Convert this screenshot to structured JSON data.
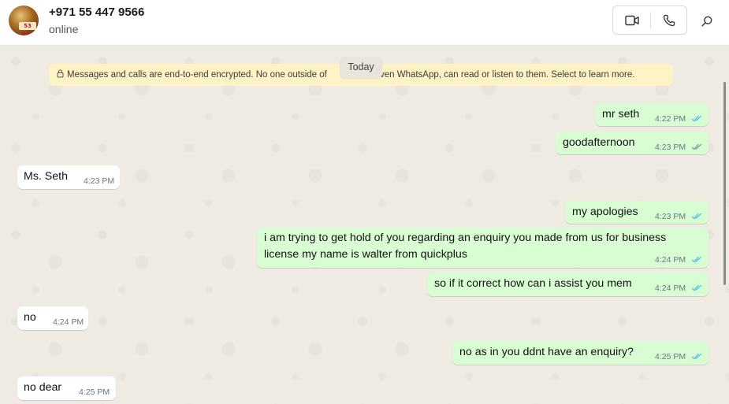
{
  "header": {
    "contact_name": "+971 55 447 9566",
    "status": "online",
    "avatar_badge": "53 UAE",
    "icons": [
      "video-call-icon",
      "voice-call-icon",
      "search-icon"
    ]
  },
  "chat": {
    "day_label": "Today",
    "encryption_notice": "Messages and calls are end-to-end encrypted. No one outside of             not even WhatsApp, can read or listen to them. Select to learn more.",
    "messages": [
      {
        "direction": "out",
        "text": "mr seth",
        "time": "4:22 PM",
        "read": true
      },
      {
        "direction": "out",
        "text": "goodafternoon",
        "time": "4:23 PM",
        "read": false
      },
      {
        "direction": "in",
        "text": "Ms. Seth",
        "time": "4:23 PM"
      },
      {
        "direction": "out",
        "text": "my apologies",
        "time": "4:23 PM",
        "read": true
      },
      {
        "direction": "out",
        "text": "i am trying to get hold of you regarding an enquiry you made from us for business license my name is walter from quickplus",
        "time": "4:24 PM",
        "read": true
      },
      {
        "direction": "out",
        "text": "so if it correct how can i assist you mem",
        "time": "4:24 PM",
        "read": true
      },
      {
        "direction": "in",
        "text": "no",
        "time": "4:24 PM"
      },
      {
        "direction": "out",
        "text": "no as in you ddnt have an enquiry?",
        "time": "4:25 PM",
        "read": true
      },
      {
        "direction": "in",
        "text": "no dear",
        "time": "4:25 PM"
      }
    ]
  },
  "colors": {
    "outgoing_bubble": "#d9fdd3",
    "incoming_bubble": "#ffffff",
    "chat_background": "#efeae2",
    "notice_background": "#fdf3c5",
    "read_tick": "#53bdeb",
    "delivered_tick": "#8696a0"
  }
}
